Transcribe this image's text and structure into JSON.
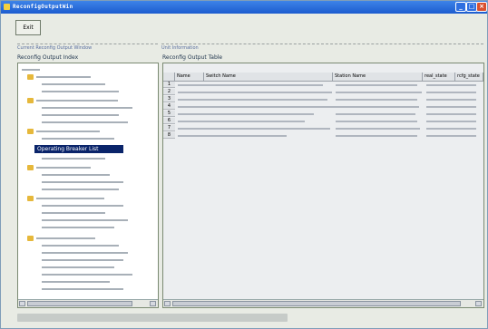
{
  "window": {
    "title": "ReconfigOutputWin"
  },
  "toolbar": {
    "exit_label": "Exit"
  },
  "info_strip": {
    "left_text": "Current Reconfig Output Window",
    "right_text": "Unit Information"
  },
  "left_pane": {
    "title": "Reconfig Output Index",
    "selected_item": "Operating Breaker List"
  },
  "right_pane": {
    "title": "Reconfig Output Table",
    "columns": [
      "Name",
      "Switch Name",
      "Station Name",
      "real_state",
      "rcfg_state"
    ],
    "row_numbers": [
      "1",
      "2",
      "3",
      "4",
      "5",
      "6",
      "7",
      "8"
    ]
  },
  "colors": {
    "titlebar": "#1c5ccf",
    "selection": "#0a246a",
    "close_button": "#d9502e"
  }
}
